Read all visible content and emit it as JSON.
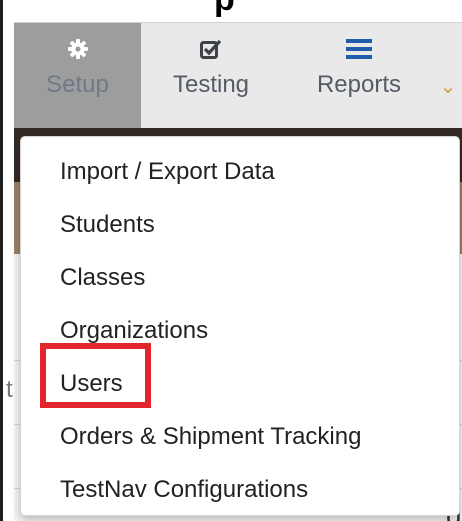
{
  "top_cropped_text": "p",
  "nav": {
    "tabs": [
      {
        "label": "Setup",
        "icon": "gear-icon",
        "active": true
      },
      {
        "label": "Testing",
        "icon": "checkbox-icon",
        "active": false
      },
      {
        "label": "Reports",
        "icon": "list-icon",
        "active": false
      }
    ],
    "overflow_glyph": "⌄"
  },
  "dropdown": {
    "items": [
      {
        "label": "Import / Export Data"
      },
      {
        "label": "Students"
      },
      {
        "label": "Classes"
      },
      {
        "label": "Organizations"
      },
      {
        "label": "Users",
        "highlighted": true
      },
      {
        "label": "Orders & Shipment Tracking"
      },
      {
        "label": "TestNav Configurations"
      }
    ],
    "highlight_color": "#e3262e"
  },
  "background_peek": {
    "left_char": "t",
    "right_char": "g"
  }
}
